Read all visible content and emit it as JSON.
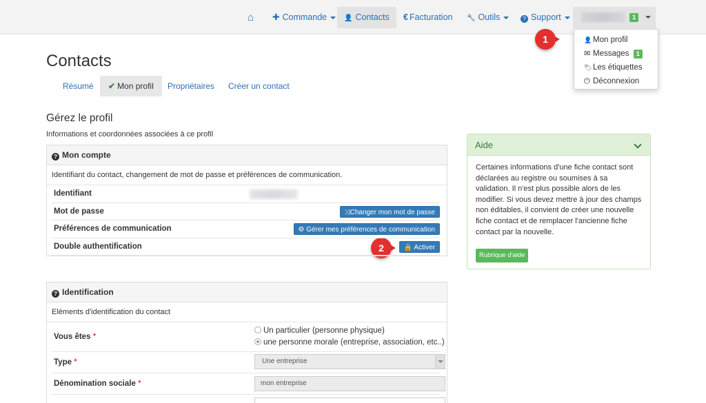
{
  "navbar": {
    "items": [
      {
        "label": "",
        "icon": "home-icon",
        "glyph": "⌂"
      },
      {
        "label": "Commande",
        "icon": "plus-icon",
        "glyph": "✚"
      },
      {
        "label": "Contacts",
        "icon": "user-icon",
        "glyph": "👤"
      },
      {
        "label": "Facturation",
        "icon": "euro-icon",
        "glyph": "€"
      },
      {
        "label": "Outils",
        "icon": "wrench-icon",
        "glyph": "🔧"
      },
      {
        "label": "Support",
        "icon": "question-circle-icon",
        "glyph": "?"
      }
    ],
    "user_badge": "1"
  },
  "user_menu": {
    "items": [
      {
        "label": "Mon profil",
        "glyph": "👤"
      },
      {
        "label": "Messages",
        "glyph": "✉",
        "badge": "1"
      },
      {
        "label": "Les étiquettes",
        "glyph": "🏷"
      },
      {
        "label": "Déconnexion",
        "glyph": "⏻"
      }
    ]
  },
  "markers": {
    "one": "1",
    "two": "2"
  },
  "page": {
    "title": "Contacts"
  },
  "subnav": {
    "tabs": [
      {
        "label": "Résumé"
      },
      {
        "label": "Mon profil",
        "check": "✔"
      },
      {
        "label": "Propriétaires"
      },
      {
        "label": "Créer un contact"
      }
    ]
  },
  "profile": {
    "title": "Gérez le profil",
    "description": "Informations et coordonnées associées à ce profil"
  },
  "account": {
    "heading": "Mon compte",
    "description": "Identifiant du contact, changement de mot de passe et préférences de communication.",
    "rows": {
      "identifiant": "Identifiant",
      "password": "Mot de passe",
      "preferences": "Préférences de communication",
      "two_factor": "Double authentification"
    },
    "buttons": {
      "change_password": "⤨Changer mon mot de passe",
      "manage_prefs": "⚙ Gérer mes préférences de communication",
      "activate": "🔒 Activer"
    }
  },
  "identification": {
    "heading": "Identification",
    "description": "Eléments d'identification du contact",
    "vous_etes": {
      "label": "Vous êtes",
      "required": "*",
      "options": [
        "Un particulier (personne physique)",
        "une personne morale (entreprise, association, etc..)"
      ],
      "selected_index": 1
    },
    "type": {
      "label": "Type",
      "required": "*",
      "value": "Une entreprise"
    },
    "denomination": {
      "label": "Dénomination sociale",
      "required": "*",
      "value": "mon entreprise"
    }
  },
  "help": {
    "title": "Aide",
    "body": "Certaines informations d'une fiche contact sont déclarées au registre ou soumises à sa validation. Il n'est plus possible alors de les modifier. Si vous devez mettre à jour des champs non éditables, il convient de créer une nouvelle fiche contact et de remplacer l'ancienne fiche contact par la nouvelle.",
    "button": "Rubrique d'aide"
  },
  "colors": {
    "link": "#2a6fb5",
    "primary": "#337ab7",
    "success": "#5cb85c",
    "marker": "#e3302f",
    "help_header": "#dff0d8"
  }
}
